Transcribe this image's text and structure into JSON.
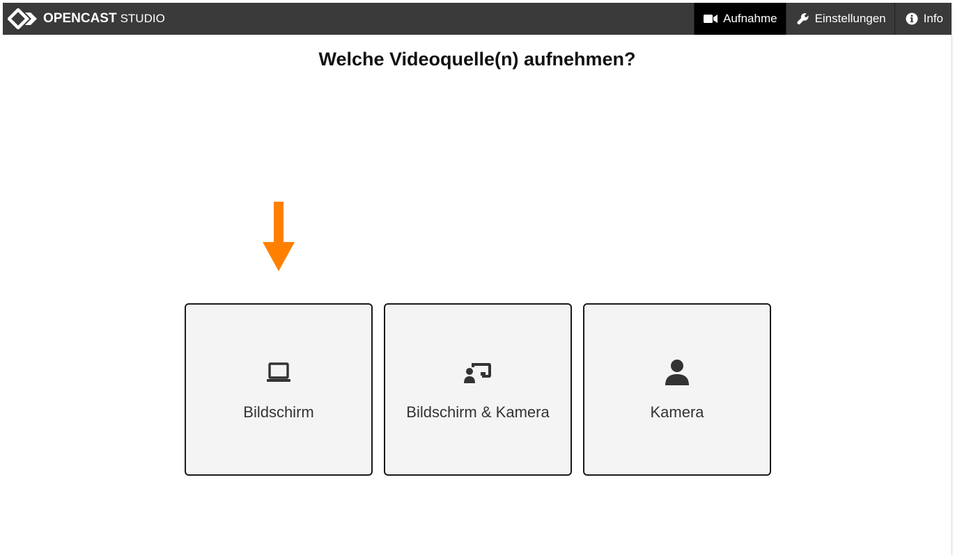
{
  "header": {
    "brand_name": "OPENCAST",
    "brand_sub": "STUDIO",
    "logo_icon": "opencast-logo-icon",
    "background": "#3a3a3a",
    "nav": [
      {
        "label": "Aufnahme",
        "icon": "video-camera-icon",
        "active": true
      },
      {
        "label": "Einstellungen",
        "icon": "wrench-icon",
        "active": false
      },
      {
        "label": "Info",
        "icon": "info-circle-icon",
        "active": false
      }
    ]
  },
  "main": {
    "title": "Welche Videoquelle(n) aufnehmen?",
    "arrow": {
      "icon": "down-arrow-icon",
      "color": "#ff8000"
    },
    "options": [
      {
        "label": "Bildschirm",
        "icon": "monitor-icon"
      },
      {
        "label": "Bildschirm & Kamera",
        "icon": "screen-and-user-icon"
      },
      {
        "label": "Kamera",
        "icon": "user-icon"
      }
    ]
  }
}
